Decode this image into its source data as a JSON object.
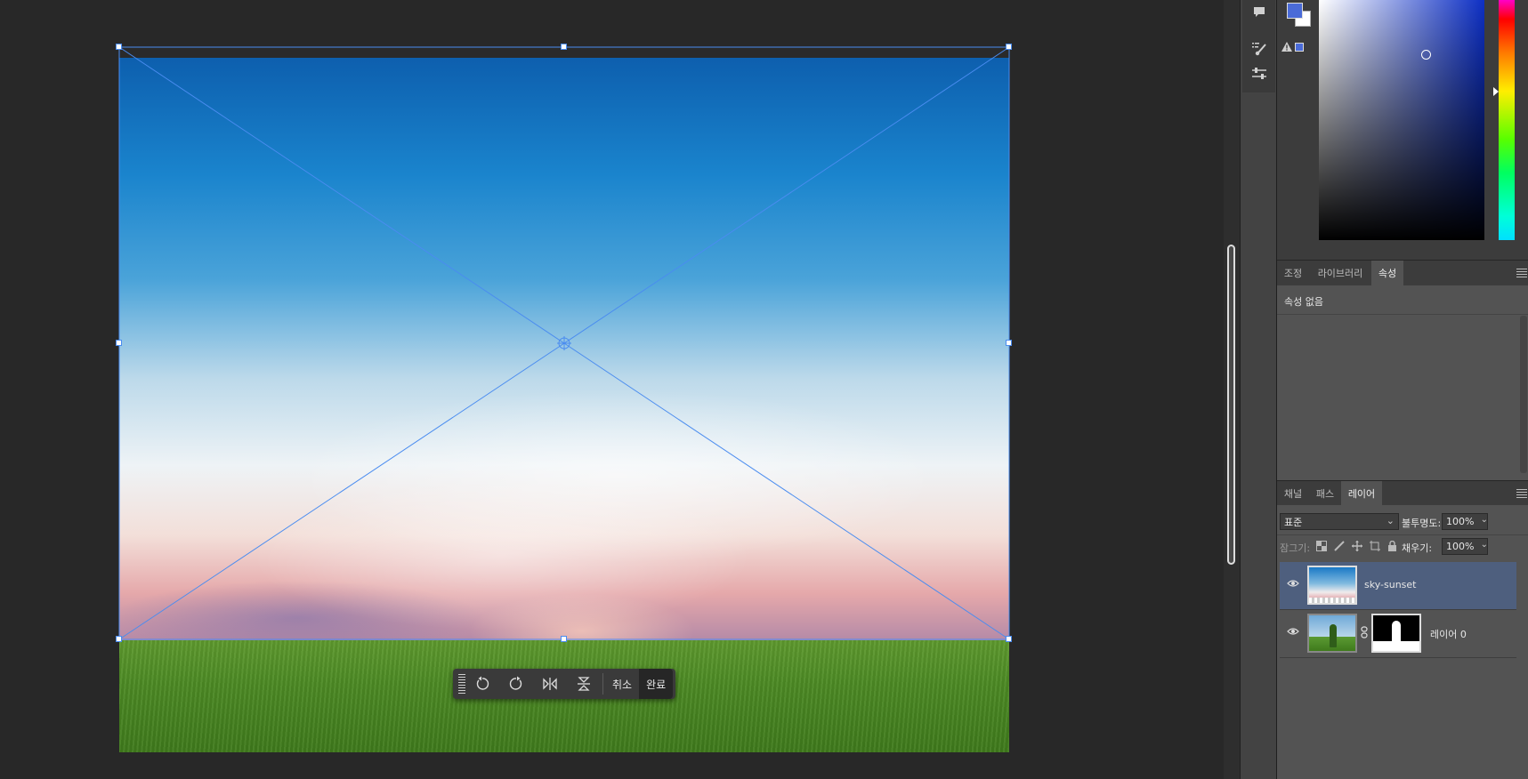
{
  "toolbar": {
    "cancel_label": "취소",
    "commit_label": "완료"
  },
  "properties": {
    "tabs": [
      "조정",
      "라이브러리",
      "속성"
    ],
    "active_tab": "속성",
    "empty_text": "속성 없음"
  },
  "layers": {
    "tabs": [
      "채널",
      "패스",
      "레이어"
    ],
    "active_tab": "레이어",
    "blend_mode": "표준",
    "opacity_label": "불투명도:",
    "opacity_value": "100%",
    "lock_label": "잠그기:",
    "fill_label": "채우기:",
    "fill_value": "100%",
    "items": [
      {
        "name": "sky-sunset",
        "selected": true
      },
      {
        "name": "레이어 0",
        "selected": false
      }
    ]
  },
  "colors": {
    "accent": "#4a8cf0",
    "foreground_swatch": "#4a6bd8",
    "background_swatch": "#ffffff",
    "selected_layer": "#4e5f7e"
  },
  "icons": [
    "comment-icon",
    "brush-settings-icon",
    "adjust-icon",
    "warning-icon",
    "rotate-ccw-icon",
    "rotate-cw-icon",
    "flip-horizontal-icon",
    "flip-vertical-icon",
    "eye-icon",
    "link-icon",
    "lock-icon"
  ]
}
